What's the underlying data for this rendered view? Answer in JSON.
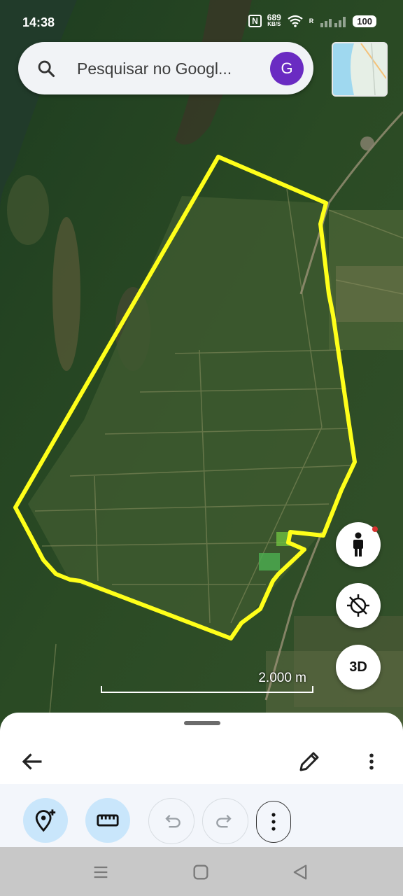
{
  "status_bar": {
    "time": "14:38",
    "nfc": "N",
    "speed_value": "689",
    "speed_unit": "KB/S",
    "roaming": "R",
    "battery": "100"
  },
  "search": {
    "placeholder": "Pesquisar no Googl...",
    "avatar_letter": "G",
    "avatar_color": "#6a2bc2"
  },
  "map": {
    "polygon_color": "#ffff1a",
    "scale_label": "2.000 m"
  },
  "map_controls": {
    "three_d_label": "3D",
    "street_view_icon": "person-icon",
    "recenter_icon": "location-off-icon"
  },
  "sheet": {
    "back_icon": "arrow-left-icon",
    "edit_icon": "pencil-icon",
    "more_icon": "more-vert-icon"
  },
  "toolbar": {
    "add_placemark_icon": "add-location-icon",
    "measure_icon": "ruler-icon",
    "undo_icon": "undo-icon",
    "redo_icon": "redo-icon",
    "more_icon": "more-vert-icon",
    "active_color": "#c9e6fb"
  },
  "nav_bar": {
    "recent_icon": "menu-icon",
    "home_icon": "home-square-icon",
    "back_icon": "triangle-back-icon"
  }
}
